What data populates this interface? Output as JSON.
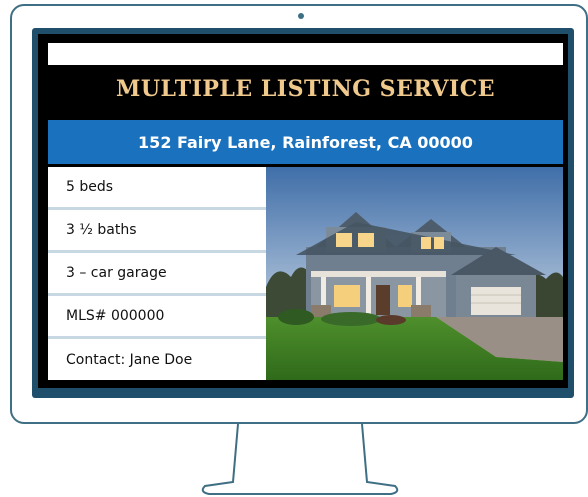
{
  "listing": {
    "title": "MULTIPLE LISTING SERVICE",
    "address": "152 Fairy Lane, Rainforest, CA 00000",
    "details": [
      "5 beds",
      "3 ½ baths",
      "3 – car garage",
      "MLS# 000000",
      "Contact: Jane Doe"
    ]
  },
  "colors": {
    "frame": "#3f6f84",
    "bezel": "#1f4f6a",
    "title_text": "#f0c98c",
    "address_bar": "#1a72bf",
    "divider": "#c7d8e2"
  },
  "icons": [
    "house-photo",
    "monitor-frame"
  ]
}
